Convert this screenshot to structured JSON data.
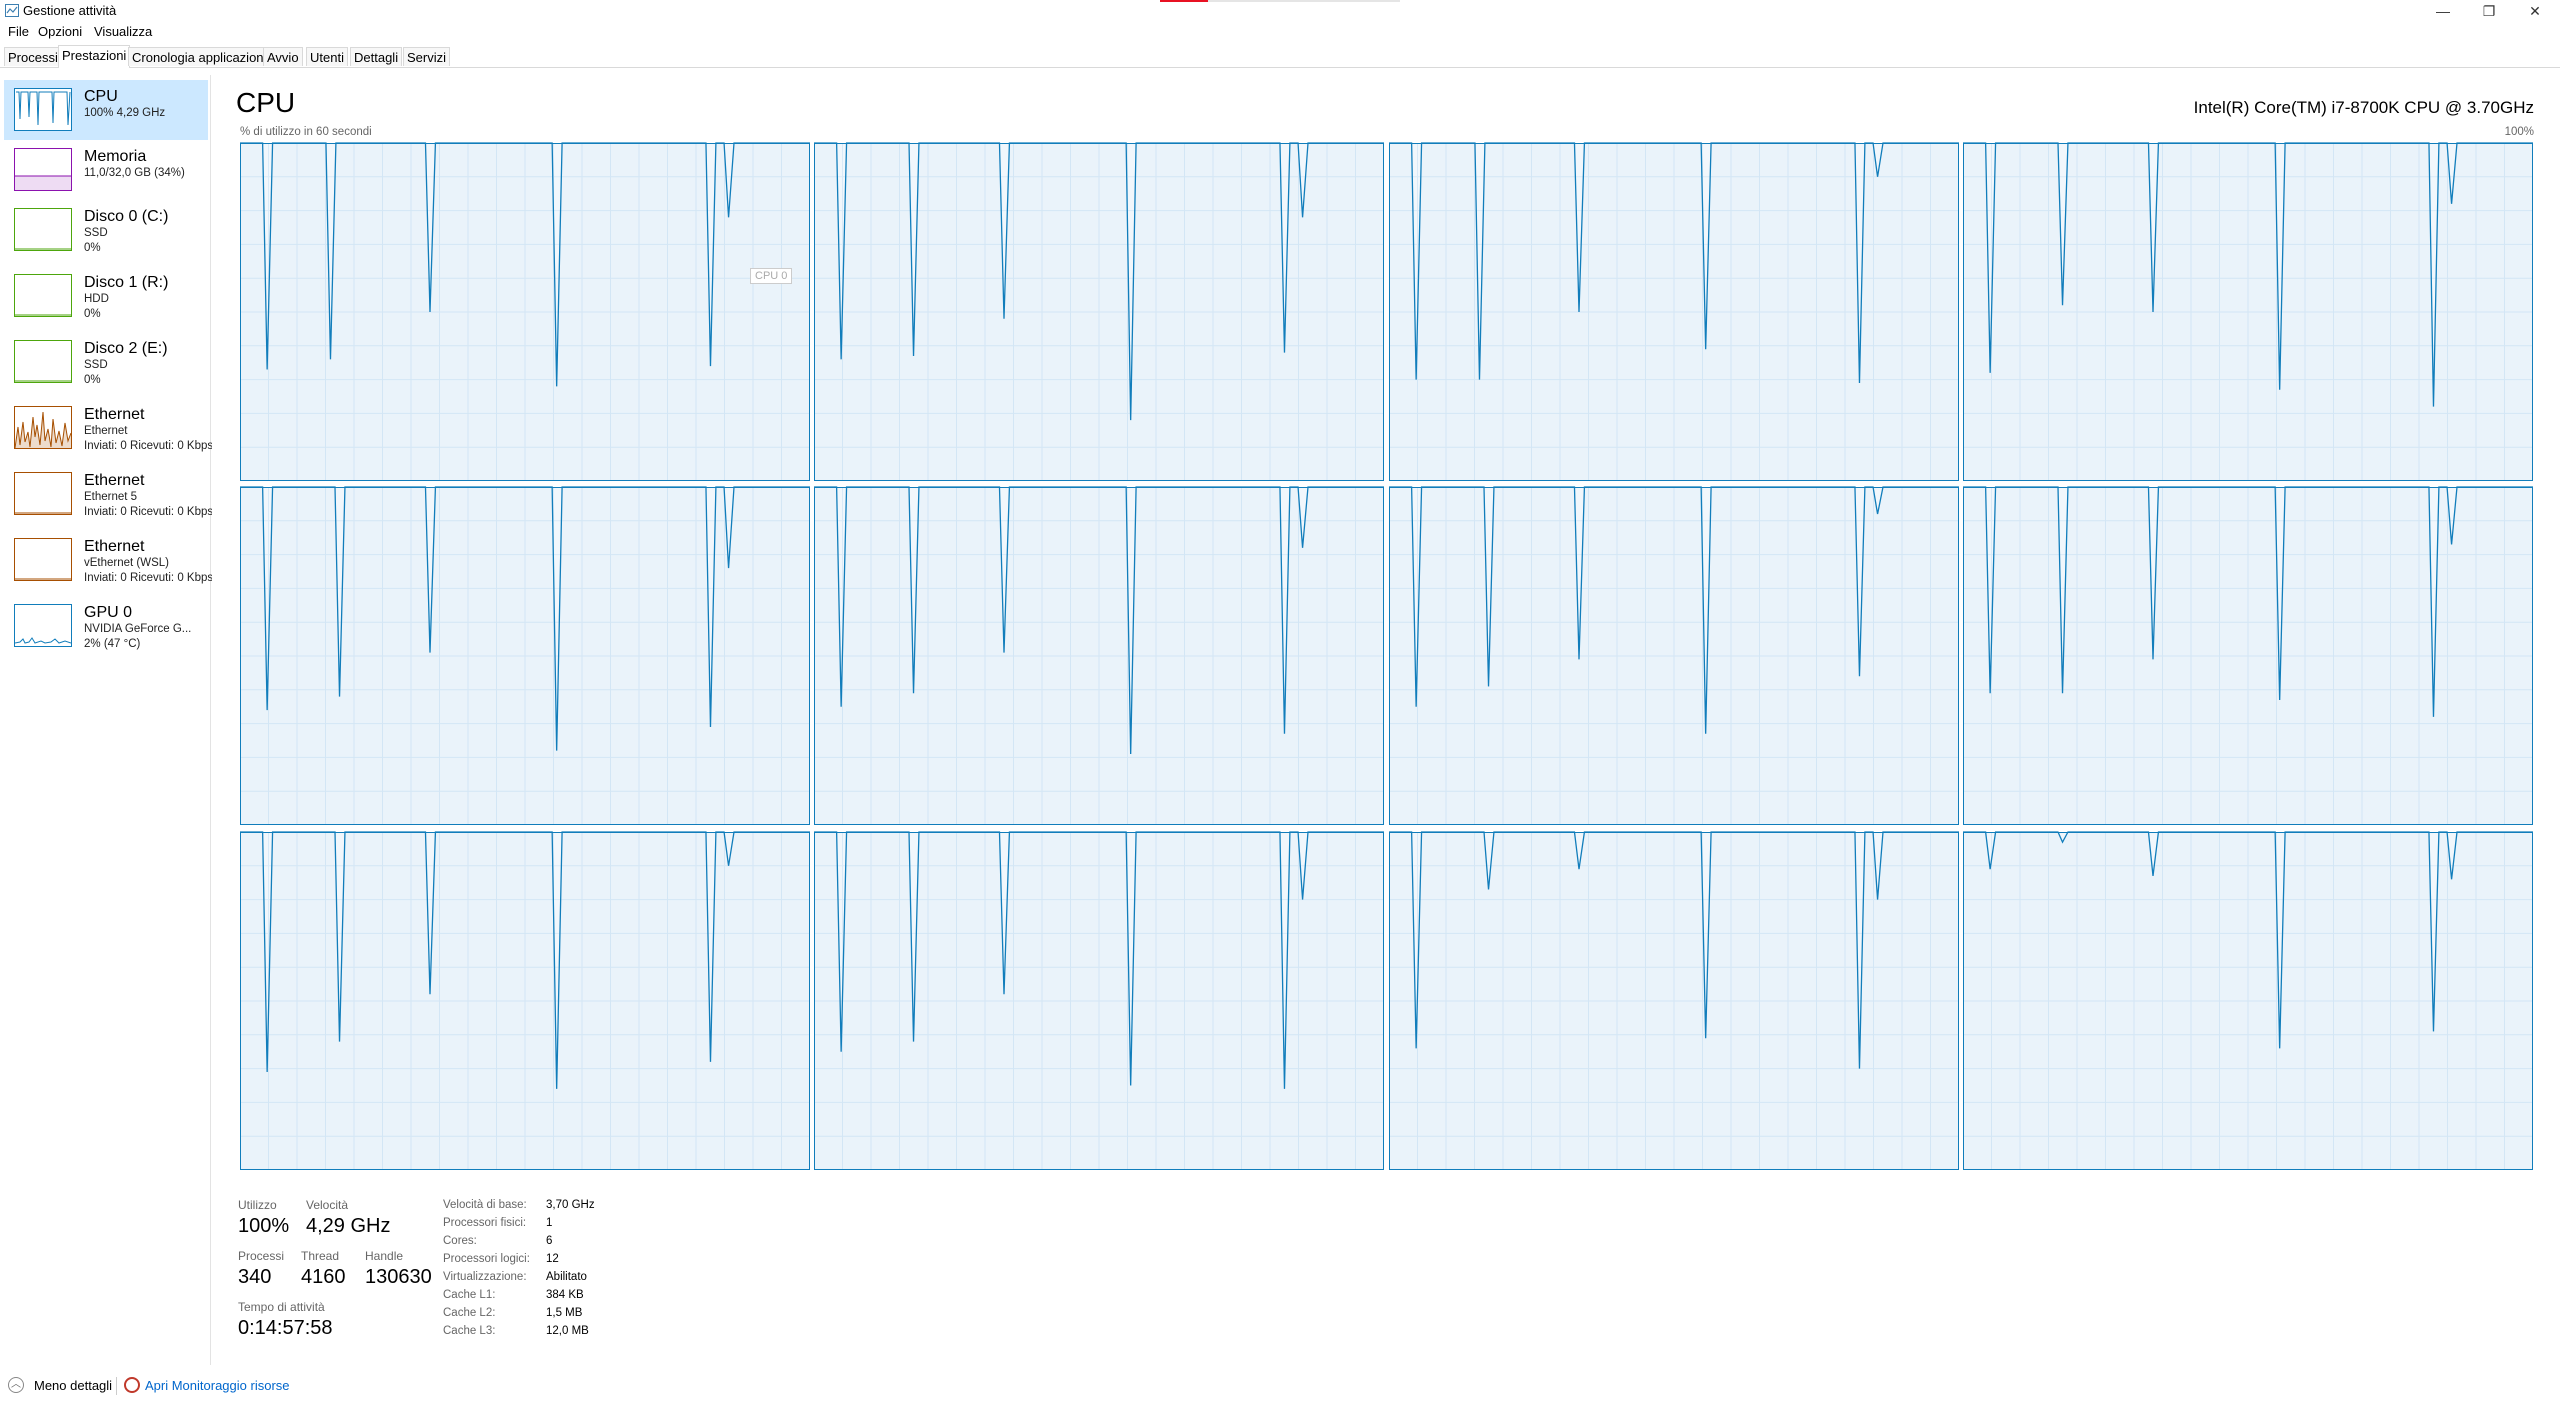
{
  "window": {
    "title": "Gestione attività",
    "controls": {
      "minimize": "—",
      "maximize": "❐",
      "close": "✕"
    }
  },
  "menu": [
    "File",
    "Opzioni",
    "Visualizza"
  ],
  "tabs": [
    {
      "label": "Processi",
      "active": false
    },
    {
      "label": "Prestazioni",
      "active": true
    },
    {
      "label": "Cronologia applicazioni",
      "active": false
    },
    {
      "label": "Avvio",
      "active": false
    },
    {
      "label": "Utenti",
      "active": false
    },
    {
      "label": "Dettagli",
      "active": false
    },
    {
      "label": "Servizi",
      "active": false
    }
  ],
  "sidebar": {
    "items": [
      {
        "title": "CPU",
        "sub1": "100% 4,29 GHz",
        "sub2": "",
        "color": "#117dbb",
        "selected": true,
        "icon": "cpu-graph-icon"
      },
      {
        "title": "Memoria",
        "sub1": "11,0/32,0 GB (34%)",
        "sub2": "",
        "color": "#8b12ae",
        "selected": false,
        "icon": "memory-graph-icon"
      },
      {
        "title": "Disco 0 (C:)",
        "sub1": "SSD",
        "sub2": "0%",
        "color": "#4da60c",
        "selected": false,
        "icon": "disk-graph-icon"
      },
      {
        "title": "Disco 1 (R:)",
        "sub1": "HDD",
        "sub2": "0%",
        "color": "#4da60c",
        "selected": false,
        "icon": "disk-graph-icon"
      },
      {
        "title": "Disco 2 (E:)",
        "sub1": "SSD",
        "sub2": "0%",
        "color": "#4da60c",
        "selected": false,
        "icon": "disk-graph-icon"
      },
      {
        "title": "Ethernet",
        "sub1": "Ethernet",
        "sub2": "Inviati: 0 Ricevuti: 0 Kbps",
        "color": "#a74f01",
        "selected": false,
        "icon": "ethernet-graph-icon"
      },
      {
        "title": "Ethernet",
        "sub1": "Ethernet 5",
        "sub2": "Inviati: 0 Ricevuti: 0 Kbps",
        "color": "#a74f01",
        "selected": false,
        "icon": "ethernet-graph-icon"
      },
      {
        "title": "Ethernet",
        "sub1": "vEthernet (WSL)",
        "sub2": "Inviati: 0 Ricevuti: 0 Kbps",
        "color": "#a74f01",
        "selected": false,
        "icon": "ethernet-graph-icon"
      },
      {
        "title": "GPU 0",
        "sub1": "NVIDIA GeForce G...",
        "sub2": "2% (47 °C)",
        "color": "#117dbb",
        "selected": false,
        "icon": "gpu-graph-icon"
      }
    ]
  },
  "main": {
    "title": "CPU",
    "cpu_model": "Intel(R) Core(TM) i7-8700K CPU @ 3.70GHz",
    "graph_caption": "% di utilizzo in 60 secondi",
    "graph_max": "100%",
    "tooltip": "CPU 0",
    "line_color": "#117dbb"
  },
  "chart_data": {
    "type": "line",
    "title": "",
    "xlabel": "",
    "ylabel": "",
    "ylim": [
      0,
      100
    ],
    "x": [
      0,
      60
    ],
    "series_count": 12,
    "series": [
      {
        "values": [
          100,
          100,
          100,
          100,
          100,
          100,
          100,
          100,
          100,
          100,
          100,
          100
        ]
      }
    ],
    "dips": [
      [
        [
          3,
          33
        ],
        [
          10,
          36
        ],
        [
          21,
          50
        ],
        [
          35,
          28
        ],
        [
          52,
          34
        ],
        [
          54,
          78
        ],
        [
          62,
          100
        ]
      ],
      [
        [
          3,
          36
        ],
        [
          11,
          37
        ],
        [
          21,
          48
        ],
        [
          35,
          18
        ],
        [
          52,
          38
        ],
        [
          54,
          78
        ],
        [
          62,
          100
        ]
      ],
      [
        [
          3,
          30
        ],
        [
          10,
          30
        ],
        [
          21,
          50
        ],
        [
          35,
          39
        ],
        [
          52,
          29
        ],
        [
          54,
          90
        ]
      ],
      [
        [
          3,
          32
        ],
        [
          11,
          52
        ],
        [
          21,
          50
        ],
        [
          35,
          27
        ],
        [
          52,
          22
        ],
        [
          54,
          82
        ]
      ],
      [
        [
          3,
          34
        ],
        [
          11,
          38
        ],
        [
          21,
          51
        ],
        [
          35,
          22
        ],
        [
          52,
          29
        ],
        [
          54,
          76
        ]
      ],
      [
        [
          3,
          35
        ],
        [
          11,
          39
        ],
        [
          21,
          51
        ],
        [
          35,
          21
        ],
        [
          52,
          27
        ],
        [
          54,
          82
        ]
      ],
      [
        [
          3,
          35
        ],
        [
          11,
          41
        ],
        [
          21,
          49
        ],
        [
          35,
          27
        ],
        [
          52,
          44
        ],
        [
          54,
          92
        ]
      ],
      [
        [
          3,
          39
        ],
        [
          11,
          39
        ],
        [
          21,
          49
        ],
        [
          35,
          37
        ],
        [
          52,
          32
        ],
        [
          54,
          83
        ]
      ],
      [
        [
          3,
          29
        ],
        [
          11,
          38
        ],
        [
          21,
          52
        ],
        [
          35,
          24
        ],
        [
          52,
          32
        ],
        [
          54,
          90
        ]
      ],
      [
        [
          3,
          35
        ],
        [
          11,
          38
        ],
        [
          21,
          52
        ],
        [
          35,
          25
        ],
        [
          52,
          24
        ],
        [
          54,
          80
        ]
      ],
      [
        [
          3,
          36
        ],
        [
          11,
          83
        ],
        [
          21,
          89
        ],
        [
          35,
          39
        ],
        [
          52,
          30
        ],
        [
          54,
          80
        ]
      ],
      [
        [
          3,
          89
        ],
        [
          11,
          97
        ],
        [
          21,
          87
        ],
        [
          35,
          36
        ],
        [
          52,
          41
        ],
        [
          54,
          86
        ]
      ]
    ]
  },
  "stats": {
    "utilization_label": "Utilizzo",
    "utilization_value": "100%",
    "speed_label": "Velocità",
    "speed_value": "4,29 GHz",
    "processes_label": "Processi",
    "processes_value": "340",
    "threads_label": "Thread",
    "threads_value": "4160",
    "handles_label": "Handle",
    "handles_value": "130630",
    "uptime_label": "Tempo di attività",
    "uptime_value": "0:14:57:58"
  },
  "specs": [
    {
      "label": "Velocità di base:",
      "value": "3,70 GHz"
    },
    {
      "label": "Processori fisici:",
      "value": "1"
    },
    {
      "label": "Cores:",
      "value": "6"
    },
    {
      "label": "Processori logici:",
      "value": "12"
    },
    {
      "label": "Virtualizzazione:",
      "value": "Abilitato"
    },
    {
      "label": "Cache L1:",
      "value": "384 KB"
    },
    {
      "label": "Cache L2:",
      "value": "1,5 MB"
    },
    {
      "label": "Cache L3:",
      "value": "12,0 MB"
    }
  ],
  "footer": {
    "less_details": "Meno dettagli",
    "resource_monitor": "Apri Monitoraggio risorse"
  }
}
